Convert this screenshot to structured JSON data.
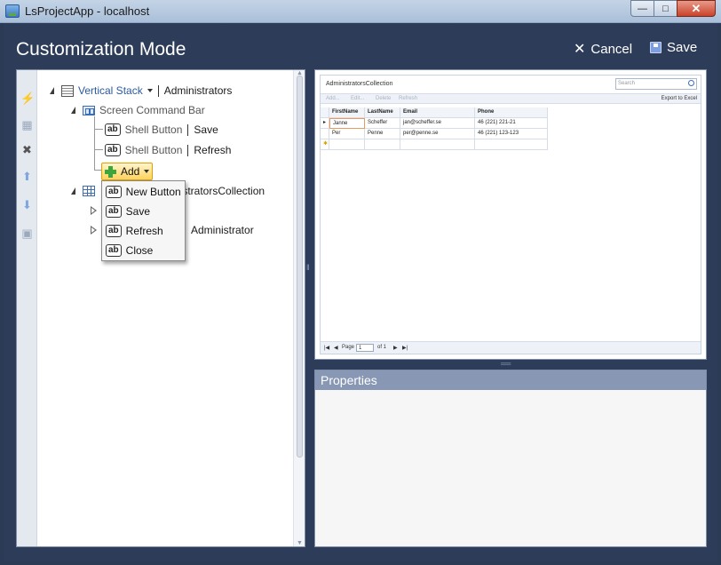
{
  "window": {
    "title": "LsProjectApp - localhost"
  },
  "header": {
    "title": "Customization Mode",
    "cancel_label": "Cancel",
    "save_label": "Save"
  },
  "tree": {
    "vertical_stack": {
      "label": "Vertical Stack",
      "value": "Administrators"
    },
    "screen_command_bar": {
      "label": "Screen Command Bar"
    },
    "shell_button_save": {
      "label": "Shell Button",
      "value": "Save"
    },
    "shell_button_refresh": {
      "label": "Shell Button",
      "value": "Refresh"
    },
    "add_label": "Add",
    "collection_partial": "nistratorsCollection",
    "administrator_partial": "Administrator",
    "dropdown_items": [
      "New Button",
      "Save",
      "Refresh",
      "Close"
    ],
    "ab_glyph": "ab"
  },
  "preview": {
    "title": "AdministratorsCollection",
    "search_placeholder": "Search",
    "commands": [
      "Add...",
      "Edit...",
      "Delete",
      "Refresh"
    ],
    "export_label": "Export to Excel",
    "columns": [
      "FirstName",
      "LastName",
      "Email",
      "Phone"
    ],
    "rows": [
      [
        "Janne",
        "Scheffer",
        "jan@scheffer.se",
        "46 (221) 221-21"
      ],
      [
        "Per",
        "Penne",
        "per@penne.se",
        "46 (221) 123-123"
      ]
    ],
    "footer": {
      "page_label": "Page",
      "page_value": "1",
      "of_label": "of 1"
    }
  },
  "properties": {
    "title": "Properties"
  },
  "colors": {
    "background": "#2d3c58",
    "accent": "#8797b4",
    "add_highlight": "#ffd35c"
  }
}
